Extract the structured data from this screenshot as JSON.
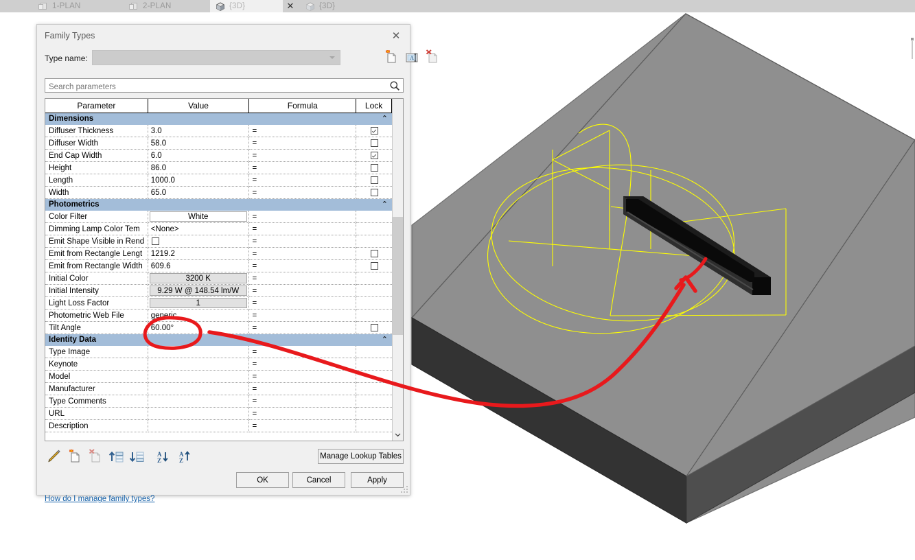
{
  "tabs": {
    "items": [
      {
        "label": "1-PLAN",
        "icon": "plan-sheet-icon",
        "active": false
      },
      {
        "label": "2-PLAN",
        "icon": "plan-sheet-icon",
        "active": false
      },
      {
        "label": "{3D}",
        "icon": "cube-3d-icon",
        "active": true
      },
      {
        "label": "{3D}",
        "icon": "cube-3d-icon",
        "active": false
      }
    ],
    "close_label": "✕"
  },
  "dialog": {
    "title": "Family Types",
    "close_label": "✕",
    "typename": {
      "label": "Type name:",
      "value": "",
      "caret_icon": "chevron-down-icon"
    },
    "typename_buttons": [
      {
        "name": "new-type-button",
        "icon": "new-document-icon"
      },
      {
        "name": "rename-type-button",
        "icon": "rename-document-icon"
      },
      {
        "name": "delete-type-button",
        "icon": "delete-document-icon"
      }
    ],
    "search": {
      "placeholder": "Search parameters",
      "value": "",
      "icon": "search-icon"
    },
    "table": {
      "columns": [
        "Parameter",
        "Value",
        "Formula",
        "Lock"
      ],
      "groups": [
        {
          "name": "Dimensions",
          "collapse_icon": "chevron-up-icon",
          "rows": [
            {
              "parameter": "Diffuser Thickness",
              "value": "3.0",
              "formula": "=",
              "lock": "checked",
              "style": "text"
            },
            {
              "parameter": "Diffuser Width",
              "value": "58.0",
              "formula": "=",
              "lock": "unchecked",
              "style": "text"
            },
            {
              "parameter": "End Cap Width",
              "value": "6.0",
              "formula": "=",
              "lock": "checked",
              "style": "text"
            },
            {
              "parameter": "Height",
              "value": "86.0",
              "formula": "=",
              "lock": "unchecked",
              "style": "text"
            },
            {
              "parameter": "Length",
              "value": "1000.0",
              "formula": "=",
              "lock": "unchecked",
              "style": "text"
            },
            {
              "parameter": "Width",
              "value": "65.0",
              "formula": "=",
              "lock": "unchecked",
              "style": "text"
            }
          ]
        },
        {
          "name": "Photometrics",
          "collapse_icon": "chevron-up-icon",
          "rows": [
            {
              "parameter": "Color Filter",
              "value": "White",
              "formula": "=",
              "lock": "none",
              "style": "swatch-button"
            },
            {
              "parameter": "Dimming Lamp Color Tem",
              "value": "<None>",
              "formula": "=",
              "lock": "none",
              "style": "text"
            },
            {
              "parameter": "Emit Shape Visible in Rend",
              "value": "",
              "formula": "=",
              "lock": "none",
              "style": "inline-checkbox"
            },
            {
              "parameter": "Emit from Rectangle Lengt",
              "value": "1219.2",
              "formula": "=",
              "lock": "unchecked",
              "style": "text"
            },
            {
              "parameter": "Emit from Rectangle Width",
              "value": "609.6",
              "formula": "=",
              "lock": "unchecked",
              "style": "text"
            },
            {
              "parameter": "Initial Color",
              "value": "3200 K",
              "formula": "=",
              "lock": "none",
              "style": "button"
            },
            {
              "parameter": "Initial Intensity",
              "value": "9.29 W @ 148.54 lm/W",
              "formula": "=",
              "lock": "none",
              "style": "button"
            },
            {
              "parameter": "Light Loss Factor",
              "value": "1",
              "formula": "=",
              "lock": "none",
              "style": "button"
            },
            {
              "parameter": "Photometric Web File",
              "value": "generic",
              "formula": "=",
              "lock": "none",
              "style": "text"
            },
            {
              "parameter": "Tilt Angle",
              "value": "60.00°",
              "formula": "=",
              "lock": "unchecked",
              "style": "text"
            }
          ]
        },
        {
          "name": "Identity Data",
          "collapse_icon": "chevron-up-icon",
          "rows": [
            {
              "parameter": "Type Image",
              "value": "",
              "formula": "=",
              "lock": "none",
              "style": "text"
            },
            {
              "parameter": "Keynote",
              "value": "",
              "formula": "=",
              "lock": "none",
              "style": "text"
            },
            {
              "parameter": "Model",
              "value": "",
              "formula": "=",
              "lock": "none",
              "style": "text"
            },
            {
              "parameter": "Manufacturer",
              "value": "",
              "formula": "=",
              "lock": "none",
              "style": "text"
            },
            {
              "parameter": "Type Comments",
              "value": "",
              "formula": "=",
              "lock": "none",
              "style": "text"
            },
            {
              "parameter": "URL",
              "value": "",
              "formula": "=",
              "lock": "none",
              "style": "text"
            },
            {
              "parameter": "Description",
              "value": "",
              "formula": "=",
              "lock": "none",
              "style": "text"
            }
          ]
        }
      ],
      "scrollbar": {
        "up_icon": "chevron-up-icon",
        "down_icon": "chevron-down-icon"
      }
    },
    "toolbar": [
      {
        "name": "edit-parameter-button",
        "icon": "pencil-icon"
      },
      {
        "name": "new-parameter-button",
        "icon": "new-document-icon"
      },
      {
        "name": "remove-parameter-button",
        "icon": "delete-document-icon"
      },
      {
        "name": "move-up-button",
        "icon": "move-up-icon"
      },
      {
        "name": "move-down-button",
        "icon": "move-down-icon"
      },
      {
        "name": "sort-ascending-button",
        "icon": "sort-az-down-icon"
      },
      {
        "name": "sort-descending-button",
        "icon": "sort-az-up-icon"
      }
    ],
    "manage_lookup_label": "Manage Lookup Tables",
    "help_link": "How do I manage family types?",
    "buttons": {
      "ok": "OK",
      "cancel": "Cancel",
      "apply": "Apply"
    },
    "resize_grip": "resize-grip-icon"
  },
  "viewport": {
    "name": "3d-view",
    "slab_top_color": "#8f8f8f",
    "slab_front_color": "#333333",
    "slab_right_color": "#4f4f4f",
    "fixture_color": "#0a0a0a",
    "light_web_color": "#ffff00",
    "background": "#ffffff"
  },
  "annotation": {
    "color": "#e8191c",
    "shapes": [
      "ellipse-highlight",
      "arrow-curve",
      "arrow-head",
      "check-mark"
    ]
  }
}
